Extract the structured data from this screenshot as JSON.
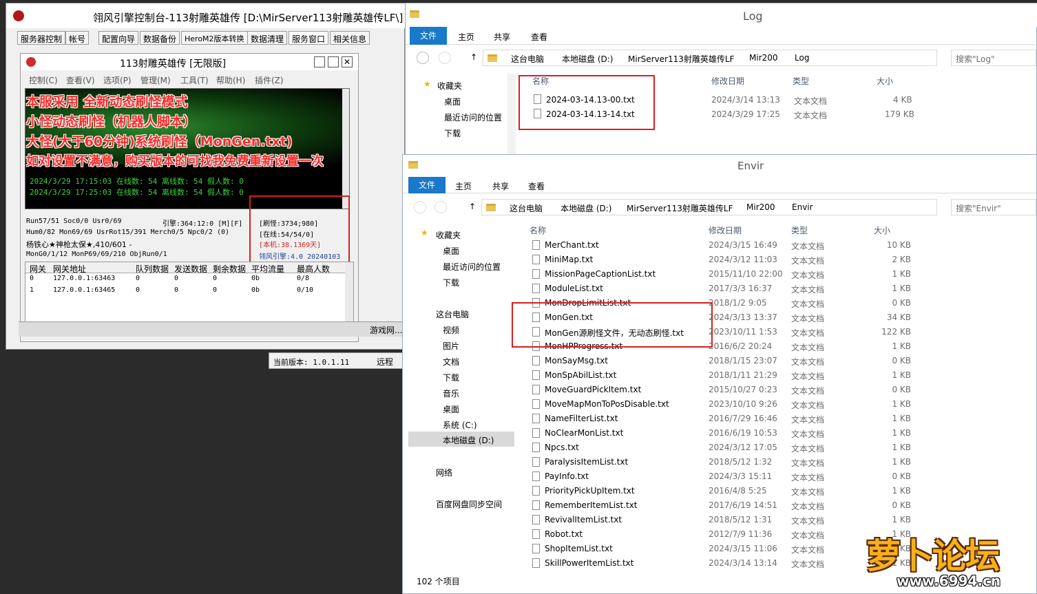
{
  "console": {
    "title": "翎风引擎控制台-113射雕英雄传 [D:\\MirServer113射雕英雄传LF\\]",
    "tabs": [
      "服务器控制",
      "帐号",
      "配置向导",
      "数据备份",
      "HeroM2版本转换",
      "数据清理",
      "服务窗口",
      "相关信息"
    ],
    "inner": {
      "title": "113射雕英雄传 [无限版]",
      "menu": [
        "控制(C)",
        "查看(V)",
        "选项(P)",
        "管理(M)",
        "工具(T)",
        "帮助(H)",
        "插件(Z)"
      ],
      "overlay": [
        "本服采用 全新动态刷怪模式",
        "小怪动态刷怪（机器人脚本）",
        "大怪(大于60分钟)系统刷怪（MonGen.txt)",
        "如对设置不满意，购买版本的可找我免费重新设置一次"
      ],
      "log": [
        "2024/3/29 17:15:03 在线数: 54 离线数: 54 假人数: 0",
        "2024/3/29 17:25:03 在线数: 54 离线数: 54 假人数: 0"
      ],
      "stats": [
        "Run57/51 Soc0/0 Usr0/69",
        "引擎:364:12:0 [M][F]",
        "Hum0/82 Mon69/69 UsrRot15/391 Merch0/5 Npc0/2 (0)",
        "杨铁心★神枪太保★,410/601 -",
        "MonG0/1/12 MonP69/69/210 ObjRun0/1"
      ],
      "right_stats": [
        "[刷怪:3734;980]",
        "[在线:54/54/0]",
        "[本机:38.1369天]",
        "翎风引擎:4.0 20240103"
      ],
      "grid_headers": [
        "网关",
        "网关地址",
        "队列数据",
        "发送数据",
        "剩余数据",
        "平均流量",
        "最高人数"
      ],
      "grid_rows": [
        [
          "0",
          "127.0.0.1:63463",
          "0",
          "0",
          "0",
          "0b",
          "0/8"
        ],
        [
          "1",
          "127.0.0.1:63465",
          "0",
          "0",
          "0",
          "0b",
          "0/10"
        ]
      ]
    },
    "taskbar_item": "游戏网...",
    "version": "当前版本: 1.0.1.11",
    "remote": "远程"
  },
  "log_window": {
    "title": "Log",
    "ribbon": [
      "文件",
      "主页",
      "共享",
      "查看"
    ],
    "path": [
      "这台电脑",
      "本地磁盘 (D:)",
      "MirServer113射雕英雄传LF",
      "Mir200",
      "Log"
    ],
    "search_placeholder": "搜索\"Log\"",
    "nav": [
      "收藏夹",
      "桌面",
      "最近访问的位置",
      "下载"
    ],
    "headers": [
      "名称",
      "修改日期",
      "类型",
      "大小"
    ],
    "files": [
      {
        "name": "2024-03-14.13-00.txt",
        "date": "2024/3/14 13:13",
        "type": "文本文档",
        "size": "4 KB"
      },
      {
        "name": "2024-03-14.13-14.txt",
        "date": "2024/3/29 17:25",
        "type": "文本文档",
        "size": "179 KB"
      }
    ]
  },
  "envir_window": {
    "title": "Envir",
    "ribbon": [
      "文件",
      "主页",
      "共享",
      "查看"
    ],
    "path": [
      "这台电脑",
      "本地磁盘 (D:)",
      "MirServer113射雕英雄传LF",
      "Mir200",
      "Envir"
    ],
    "search_placeholder": "搜索\"Envir\"",
    "nav": [
      "收藏夹",
      "桌面",
      "最近访问的位置",
      "下载",
      "这台电脑",
      "视频",
      "图片",
      "文档",
      "下载",
      "音乐",
      "桌面",
      "系统 (C:)",
      "本地磁盘 (D:)",
      "网络",
      "百度网盘同步空间"
    ],
    "headers": [
      "名称",
      "修改日期",
      "类型",
      "大小"
    ],
    "files": [
      {
        "name": "MerChant.txt",
        "date": "2024/3/15 16:49",
        "type": "文本文档",
        "size": "10 KB"
      },
      {
        "name": "MiniMap.txt",
        "date": "2024/3/12 11:03",
        "type": "文本文档",
        "size": "2 KB"
      },
      {
        "name": "MissionPageCaptionList.txt",
        "date": "2015/11/10 22:00",
        "type": "文本文档",
        "size": "1 KB"
      },
      {
        "name": "ModuleList.txt",
        "date": "2017/3/3 16:37",
        "type": "文本文档",
        "size": "1 KB"
      },
      {
        "name": "MonDropLimitList.txt",
        "date": "2018/1/2 9:05",
        "type": "文本文档",
        "size": "0 KB"
      },
      {
        "name": "MonGen.txt",
        "date": "2024/3/13 13:37",
        "type": "文本文档",
        "size": "34 KB"
      },
      {
        "name": "MonGen源刷怪文件，无动态刷怪.txt",
        "date": "2023/10/11 1:53",
        "type": "文本文档",
        "size": "122 KB"
      },
      {
        "name": "MonHPProgress.txt",
        "date": "2016/6/2 20:24",
        "type": "文本文档",
        "size": "1 KB"
      },
      {
        "name": "MonSayMsg.txt",
        "date": "2018/1/15 23:07",
        "type": "文本文档",
        "size": "0 KB"
      },
      {
        "name": "MonSpAbilList.txt",
        "date": "2018/1/11 21:29",
        "type": "文本文档",
        "size": "1 KB"
      },
      {
        "name": "MoveGuardPickItem.txt",
        "date": "2015/10/27 0:23",
        "type": "文本文档",
        "size": "0 KB"
      },
      {
        "name": "MoveMapMonToPosDisable.txt",
        "date": "2023/10/10 9:26",
        "type": "文本文档",
        "size": "1 KB"
      },
      {
        "name": "NameFilterList.txt",
        "date": "2016/7/29 16:46",
        "type": "文本文档",
        "size": "1 KB"
      },
      {
        "name": "NoClearMonList.txt",
        "date": "2016/6/19 10:53",
        "type": "文本文档",
        "size": "1 KB"
      },
      {
        "name": "Npcs.txt",
        "date": "2024/3/12 17:05",
        "type": "文本文档",
        "size": "1 KB"
      },
      {
        "name": "ParalysisItemList.txt",
        "date": "2018/5/12 1:32",
        "type": "文本文档",
        "size": "1 KB"
      },
      {
        "name": "PayInfo.txt",
        "date": "2024/3/3 15:11",
        "type": "文本文档",
        "size": "0 KB"
      },
      {
        "name": "PriorityPickUpItem.txt",
        "date": "2016/4/8 5:25",
        "type": "文本文档",
        "size": "1 KB"
      },
      {
        "name": "RememberItemList.txt",
        "date": "2017/6/19 14:51",
        "type": "文本文档",
        "size": "0 KB"
      },
      {
        "name": "RevivalItemList.txt",
        "date": "2018/5/12 1:31",
        "type": "文本文档",
        "size": "1 KB"
      },
      {
        "name": "Robot.txt",
        "date": "2012/7/9 11:36",
        "type": "文本文档",
        "size": "1 KB"
      },
      {
        "name": "ShopItemList.txt",
        "date": "2024/3/15 11:06",
        "type": "文本文档",
        "size": "1 KB"
      },
      {
        "name": "SkillPowerItemList.txt",
        "date": "2024/3/14 13:14",
        "type": "文本文档",
        "size": "1 KB"
      }
    ],
    "item_count": "102 个项目"
  },
  "watermark": {
    "logo_text": "萝卜论坛",
    "url": "www.6994.cn"
  },
  "colors": {
    "accent": "#1979ca",
    "highlight_red": "#d42020"
  }
}
